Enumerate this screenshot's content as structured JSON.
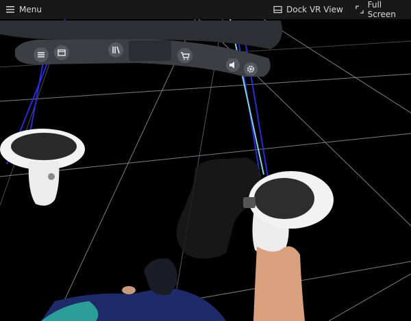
{
  "topbar": {
    "menu_label": "Menu",
    "dock_label": "Dock VR View",
    "fullscreen_label": "Full Screen",
    "menu_icon": "hamburger-icon",
    "dock_icon": "dock-window-icon",
    "fullscreen_icon": "expand-icon"
  },
  "vr_dock": {
    "buttons": [
      {
        "name": "menu-icon"
      },
      {
        "name": "window-icon"
      },
      {
        "name": "library-icon"
      },
      {
        "name": "store-cart-icon"
      },
      {
        "name": "volume-icon"
      },
      {
        "name": "settings-gear-icon"
      }
    ]
  },
  "colors": {
    "topbar_bg": "#181818",
    "scene_bg": "#000000",
    "grid": "#8a8f96",
    "dock": "#3a3d42",
    "controller": "#eeeeee",
    "laser_cyan": "#7fd6e0",
    "laser_blue": "#2222cc"
  }
}
